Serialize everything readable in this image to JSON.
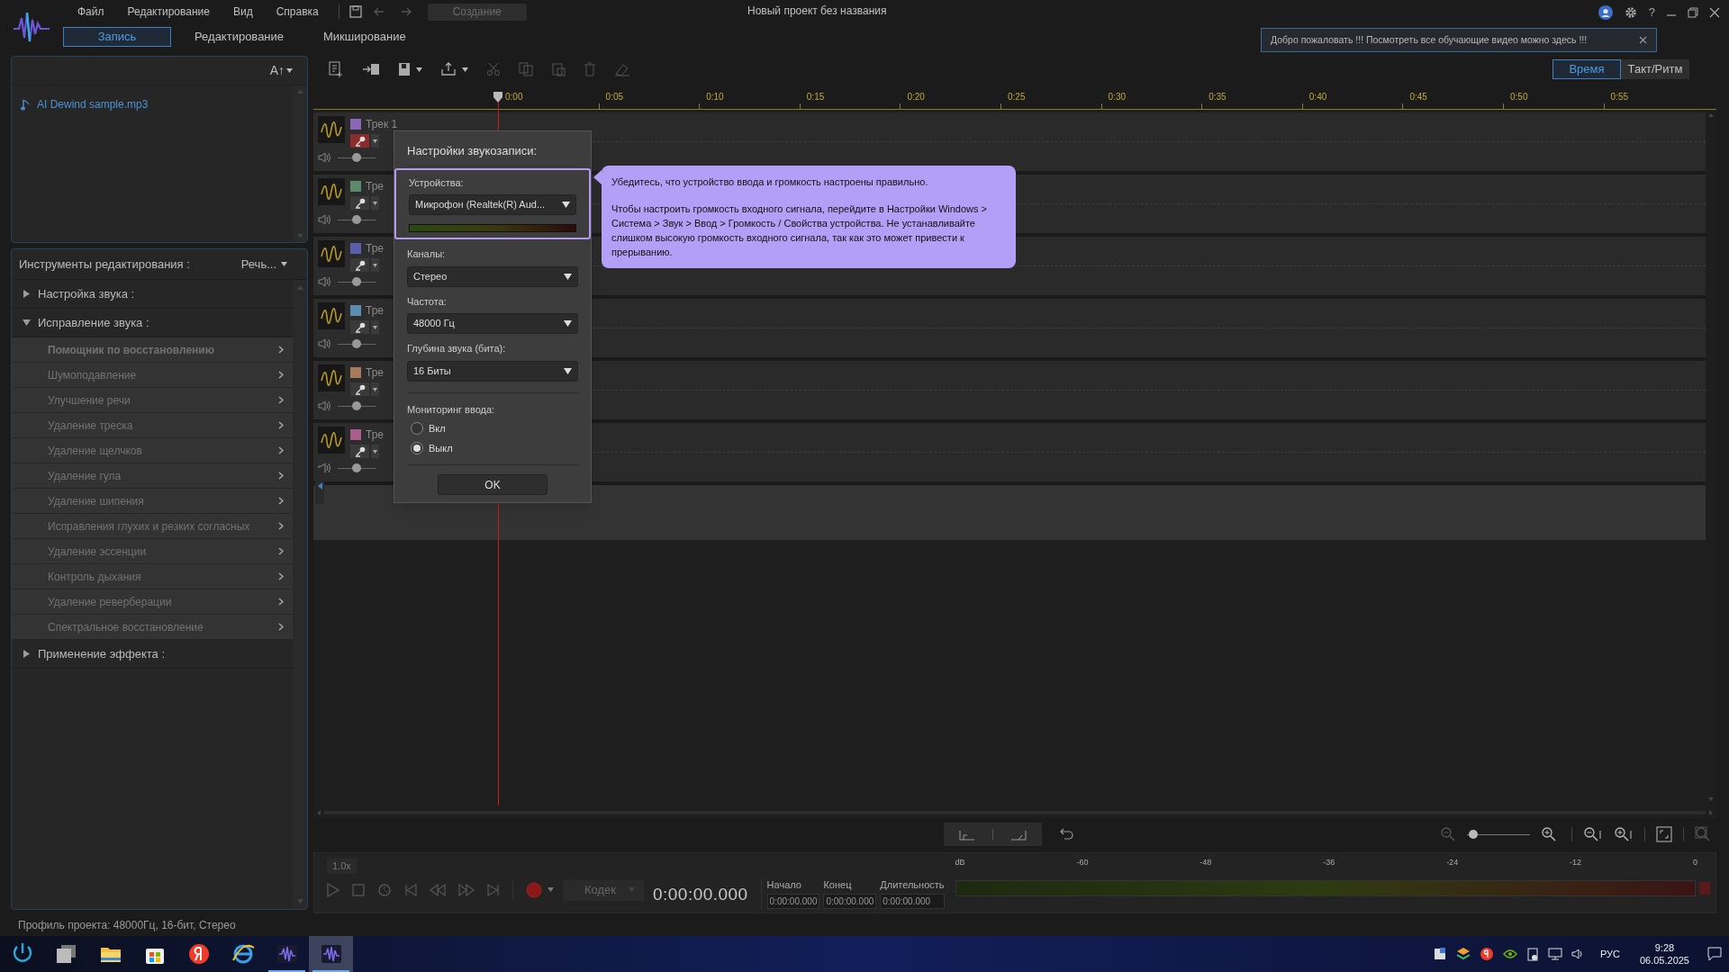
{
  "menu": [
    "Файл",
    "Редактирование",
    "Вид",
    "Справка"
  ],
  "create_button": "Создание",
  "window_title": "Новый проект без названия",
  "help_label": "?",
  "mode_tabs": [
    {
      "label": "Запись",
      "selected": true
    },
    {
      "label": "Редактирование",
      "selected": false
    },
    {
      "label": "Микширование",
      "selected": false
    }
  ],
  "welcome_banner": "Добро пожаловать !!! Посмотреть все обучающие видео можно здесь !!!",
  "media_panel": {
    "sort_button": "A↑",
    "files": [
      "AI Dewind sample.mp3"
    ]
  },
  "tools_panel": {
    "title": "Инструменты редактирования :",
    "preset": "Речь...",
    "sections": [
      {
        "label": "Настройка звука :",
        "expanded": false
      },
      {
        "label": "Исправление звука :",
        "expanded": true,
        "children": [
          {
            "label": "Помощник по восстановлению",
            "selected": true,
            "disabled": true
          },
          {
            "label": "Шумоподавление",
            "selected": false,
            "disabled": true
          },
          {
            "label": "Улучшение речи",
            "selected": false,
            "disabled": true
          },
          {
            "label": "Удаление треска",
            "selected": false,
            "disabled": true
          },
          {
            "label": "Удаление щелчков",
            "selected": false,
            "disabled": true
          },
          {
            "label": "Удаление гула",
            "selected": false,
            "disabled": true
          },
          {
            "label": "Удаление шипения",
            "selected": false,
            "disabled": true
          },
          {
            "label": "Исправления глухих и резких согласных",
            "selected": false,
            "disabled": true
          },
          {
            "label": "Удаление эссенции",
            "selected": false,
            "disabled": true
          },
          {
            "label": "Контроль дыхания",
            "selected": false,
            "disabled": true
          },
          {
            "label": "Удаление реверберации",
            "selected": false,
            "disabled": true
          },
          {
            "label": "Спектральное восстановление",
            "selected": false,
            "disabled": true
          }
        ]
      },
      {
        "label": "Применение эффекта :",
        "expanded": false
      }
    ]
  },
  "timeline": {
    "view_toggle": [
      {
        "label": "Время",
        "selected": true
      },
      {
        "label": "Такт/Ритм",
        "selected": false
      }
    ],
    "ruler": [
      "0:00",
      "0:05",
      "0:10",
      "0:15",
      "0:20",
      "0:25",
      "0:30",
      "0:35",
      "0:40",
      "0:45",
      "0:50",
      "0:55"
    ],
    "tracks": [
      {
        "name": "Трек 1",
        "color": "#8b65b8",
        "armed": true,
        "level": 0.5
      },
      {
        "name": "Тре",
        "color": "#5e8a6a",
        "armed": false,
        "level": 0.5
      },
      {
        "name": "Тре",
        "color": "#5a5fad",
        "armed": false,
        "level": 0.5
      },
      {
        "name": "Тре",
        "color": "#5a8db0",
        "armed": false,
        "level": 0.5
      },
      {
        "name": "Тре",
        "color": "#a87a5c",
        "armed": false,
        "level": 0.5
      },
      {
        "name": "Тре",
        "color": "#a85d8c",
        "armed": false,
        "level": 0.5
      }
    ],
    "zoom": {
      "level": 0.1
    }
  },
  "dialog": {
    "title": "Настройки звукозаписи:",
    "fields": [
      {
        "label": "Устройства:",
        "value": "Микрофон (Realtek(R) Aud...",
        "highlighted": true,
        "has_meter": true
      },
      {
        "label": "Каналы:",
        "value": "Стерео",
        "highlighted": false,
        "has_meter": false
      },
      {
        "label": "Частота:",
        "value": "48000 Гц",
        "highlighted": false,
        "has_meter": false
      },
      {
        "label": "Глубина звука (бита):",
        "value": "16 Биты",
        "highlighted": false,
        "has_meter": false
      }
    ],
    "monitoring": {
      "label": "Мониторинг ввода:",
      "options": [
        {
          "label": "Вкл",
          "selected": false
        },
        {
          "label": "Выкл",
          "selected": true
        }
      ]
    },
    "ok_button": "OK"
  },
  "tooltip": [
    "Убедитесь, что устройство ввода и громкость настроены правильно.",
    "Чтобы настроить громкость входного сигнала, перейдите в Настройки Windows > Система > Звук > Ввод > Громкость / Свойства устройства. Не устанавливайте слишком высокую громкость входного сигнала, так как это может привести к прерыванию."
  ],
  "transport": {
    "speed": "1.0x",
    "codec": "Кодек",
    "time": "0:00:00.000",
    "fields": [
      {
        "label": "Начало",
        "value": "0:00:00.000"
      },
      {
        "label": "Конец",
        "value": "0:00:00.000"
      },
      {
        "label": "Длительность",
        "value": "0:00:00.000"
      }
    ],
    "meter_scale": [
      "dB",
      "-60",
      "-48",
      "-36",
      "-24",
      "-12",
      "0"
    ]
  },
  "status_bar": "Профиль проекта: 48000Гц, 16-бит, Стерео",
  "taskbar": {
    "apps": [
      {
        "kind": "power",
        "running": false,
        "selected": false
      },
      {
        "kind": "task-view",
        "running": false,
        "selected": false
      },
      {
        "kind": "folder",
        "running": false,
        "selected": false
      },
      {
        "kind": "store",
        "running": false,
        "selected": false
      },
      {
        "kind": "yandex",
        "running": false,
        "selected": false
      },
      {
        "kind": "browser",
        "running": false,
        "selected": false
      },
      {
        "kind": "audio-app",
        "running": true,
        "selected": false
      },
      {
        "kind": "audio-app",
        "running": true,
        "selected": true
      }
    ],
    "language": "РУС",
    "time": "9:28",
    "date": "06.05.2025"
  }
}
